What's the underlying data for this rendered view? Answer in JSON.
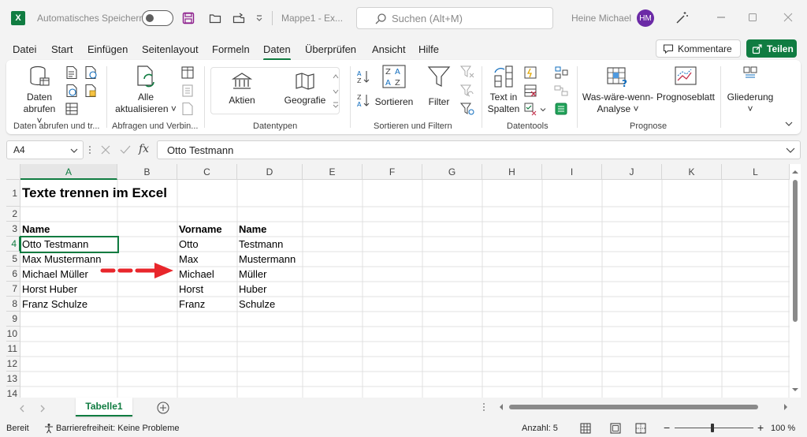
{
  "titlebar": {
    "app_logo": "X",
    "autosave_label": "Automatisches Speichern",
    "doc_title": "Mappe1  -  Ex...",
    "search_placeholder": "Suchen (Alt+M)",
    "user_name": "Heine Michael",
    "avatar_initials": "HM"
  },
  "menu": {
    "tabs": [
      "Datei",
      "Start",
      "Einfügen",
      "Seitenlayout",
      "Formeln",
      "Daten",
      "Überprüfen",
      "Ansicht",
      "Hilfe"
    ],
    "active": "Daten",
    "comments_label": "Kommentare",
    "share_label": "Teilen"
  },
  "ribbon": {
    "get_data_line1": "Daten",
    "get_data_line2": "abrufen",
    "refresh_line1": "Alle",
    "refresh_line2": "aktualisieren",
    "stocks_label": "Aktien",
    "geo_label": "Geografie",
    "sort_label": "Sortieren",
    "filter_label": "Filter",
    "text_to_cols_line1": "Text in",
    "text_to_cols_line2": "Spalten",
    "whatif_line1": "Was-wäre-wenn-",
    "whatif_line2": "Analyse",
    "forecast_label": "Prognoseblatt",
    "outline_label": "Gliederung",
    "groups": {
      "get_data": "Daten abrufen und tr...",
      "queries": "Abfragen und Verbin...",
      "datatypes": "Datentypen",
      "sort_filter": "Sortieren und Filtern",
      "datatools": "Datentools",
      "forecast": "Prognose"
    }
  },
  "formula": {
    "name_box": "A4",
    "fx": "fx",
    "content": "Otto Testmann"
  },
  "grid": {
    "columns": [
      "A",
      "B",
      "C",
      "D",
      "E",
      "F",
      "G",
      "H",
      "I",
      "J",
      "K",
      "L"
    ],
    "rows": [
      "1",
      "2",
      "3",
      "4",
      "5",
      "6",
      "7",
      "8",
      "9",
      "10",
      "11",
      "12",
      "13",
      "14"
    ],
    "title": "Texte trennen im Excel",
    "header_a": "Name",
    "header_c": "Vorname",
    "header_d": "Name",
    "full_names": [
      "Otto Testmann",
      "Max Mustermann",
      "Michael Müller",
      "Horst Huber",
      "Franz Schulze"
    ],
    "first_names": [
      "Otto",
      "Max",
      "Michael",
      "Horst",
      "Franz"
    ],
    "last_names": [
      "Testmann",
      "Mustermann",
      "Müller",
      "Huber",
      "Schulze"
    ],
    "arrow_color": "#e8262b"
  },
  "sheets": {
    "tabs": [
      "Tabelle1"
    ],
    "accent": "#107c41"
  },
  "status": {
    "ready": "Bereit",
    "accessibility": "Barrierefreiheit: Keine Probleme",
    "count": "Anzahl: 5",
    "zoom": "100 %"
  }
}
